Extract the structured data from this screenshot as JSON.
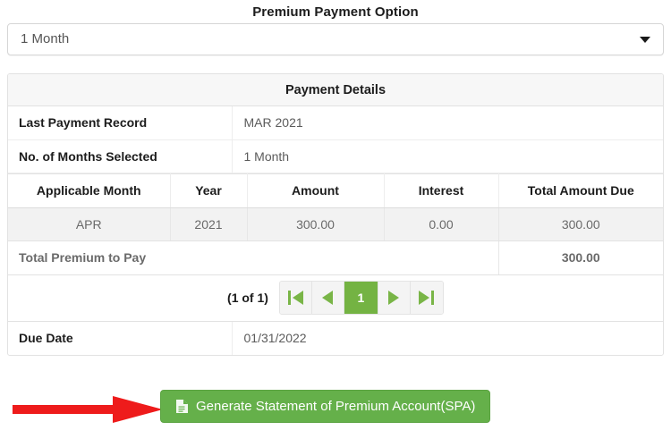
{
  "form": {
    "label": "Premium Payment Option",
    "select": {
      "name": "premium-payment-option",
      "value": "1 Month",
      "placeholder": "1 Month",
      "caret_icon": "chevron-down-icon"
    }
  },
  "card": {
    "header": "Payment Details",
    "info_rows": [
      {
        "label": "Last Payment Record",
        "value": "MAR 2021"
      },
      {
        "label": "No. of Months Selected",
        "value": "1 Month"
      }
    ],
    "table": {
      "columns": [
        "Applicable Month",
        "Year",
        "Amount",
        "Interest",
        "Total Amount Due"
      ],
      "rows": [
        {
          "month": "APR",
          "year": "2021",
          "amount": "300.00",
          "interest": "0.00",
          "total": "300.00"
        }
      ],
      "total_label": "Total Premium to Pay",
      "total_value": "300.00"
    },
    "pager": {
      "count_text": "(1 of 1)",
      "first_label": "first-page",
      "prev_label": "previous-page",
      "current_page": "1",
      "next_label": "next-page",
      "last_label": "last-page"
    },
    "due_row": {
      "label": "Due Date",
      "value": "01/31/2022"
    }
  },
  "action": {
    "button_label": "Generate Statement of Premium Account(SPA)",
    "button_icon": "document-icon",
    "annotation_arrow": "red-arrow-annotation"
  },
  "colors": {
    "button_green": "#65b04a",
    "pager_green": "#74b343",
    "arrow_red": "#ee1b1b",
    "row_gray": "#f2f2f2",
    "header_gray": "#f7f7f7"
  }
}
